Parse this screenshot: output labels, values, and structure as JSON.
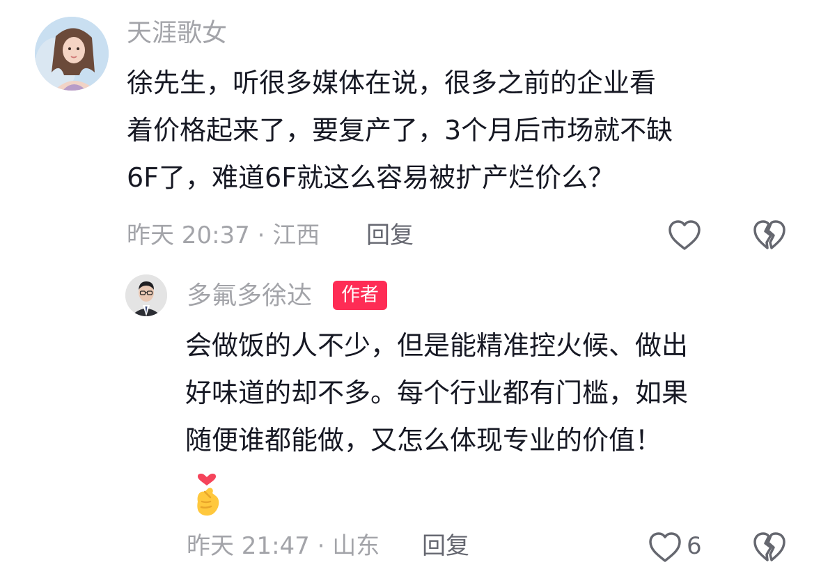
{
  "main_comment": {
    "username": "天涯歌女",
    "text": "徐先生，听很多媒体在说，很多之前的企业看\n着价格起来了，要复产了，3个月后市场就不缺\n6F了，难道6F就这么容易被扩产烂价么？",
    "meta": "昨天 20:37 · 江西",
    "reply_label": "回复",
    "avatar_icon": "user-avatar-photo",
    "like_icon": "heart-outline-icon",
    "dislike_icon": "broken-heart-icon"
  },
  "reply_comment": {
    "username": "多氟多徐达",
    "badge": "作者",
    "badge_color": "#fe2c55",
    "text": "会做饭的人不少，但是能精准控火候、做出\n好味道的却不多。每个行业都有门槛，如果\n随便谁都能做，又怎么体现专业的价值！",
    "emoji": "finger-heart-emoji",
    "meta": "昨天 21:47 · 山东",
    "reply_label": "回复",
    "like_count": "6",
    "avatar_icon": "author-avatar-photo",
    "like_icon": "heart-outline-icon",
    "dislike_icon": "broken-heart-icon"
  },
  "colors": {
    "text_primary": "#161823",
    "text_secondary": "#a3a4a9",
    "action_text": "#656770"
  }
}
